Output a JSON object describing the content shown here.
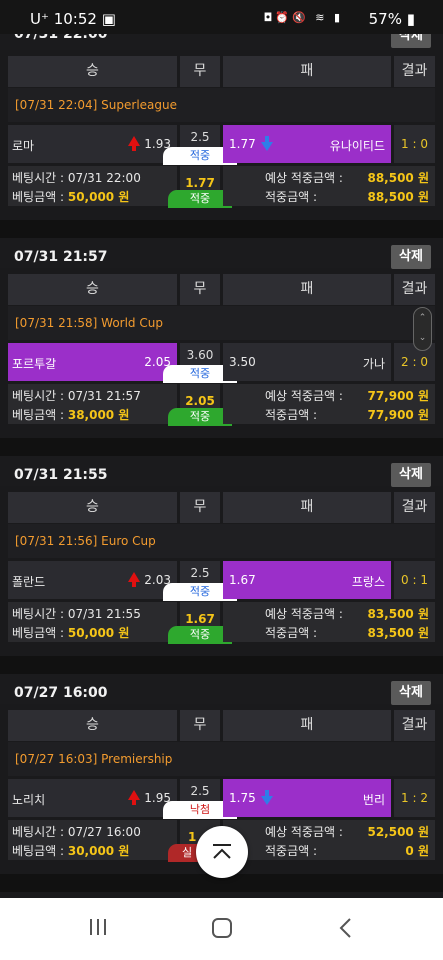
{
  "status_bar": {
    "carrier": "U⁺",
    "time": "10:52",
    "battery": "57%"
  },
  "table_headers": {
    "win": "승",
    "draw": "무",
    "lose": "패",
    "result": "결과"
  },
  "delete_label": "삭제",
  "labels": {
    "bet_time": "베팅시간 : ",
    "bet_amount": "베팅금액 : ",
    "expected_win": "예상 적중금액 :",
    "win_amount": "적중금액 :"
  },
  "bets": [
    {
      "date": "07/31 22:00",
      "league": "[07/31 22:04] Superleague",
      "home": "로마",
      "home_odds": "1.93",
      "draw_odds": "2.5",
      "away": "유나이티드",
      "away_odds": "1.77",
      "result": "1 : 0",
      "status": "적중",
      "bet_time": "07/31 22:00",
      "bet_amount": "50,000 원",
      "picked_odds": "1.77",
      "pick_status": "적중",
      "expected": "88,500 원",
      "won": "88,500 원"
    },
    {
      "date": "07/31 21:57",
      "league": "[07/31 21:58] World Cup",
      "home": "포르투갈",
      "home_odds": "2.05",
      "draw_odds": "3.60",
      "away": "가나",
      "away_odds": "3.50",
      "result": "2 : 0",
      "status": "적중",
      "bet_time": "07/31 21:57",
      "bet_amount": "38,000 원",
      "picked_odds": "2.05",
      "pick_status": "적중",
      "expected": "77,900 원",
      "won": "77,900 원"
    },
    {
      "date": "07/31 21:55",
      "league": "[07/31 21:56] Euro Cup",
      "home": "폴란드",
      "home_odds": "2.03",
      "draw_odds": "2.5",
      "away": "프랑스",
      "away_odds": "1.67",
      "result": "0 : 1",
      "status": "적중",
      "bet_time": "07/31 21:55",
      "bet_amount": "50,000 원",
      "picked_odds": "1.67",
      "pick_status": "적중",
      "expected": "83,500 원",
      "won": "83,500 원"
    },
    {
      "date": "07/27 16:00",
      "league": "[07/27 16:03] Premiership",
      "home": "노리치",
      "home_odds": "1.95",
      "draw_odds": "2.5",
      "away": "번리",
      "away_odds": "1.75",
      "result": "1 : 2",
      "status": "낙첨",
      "bet_time": "07/27 16:00",
      "bet_amount": "30,000 원",
      "picked_odds": "1",
      "pick_status": "실",
      "expected": "52,500 원",
      "won": "0 원"
    }
  ],
  "colors": {
    "accent_purple": "#9b2fc9",
    "win_green": "#2ea82e",
    "league_orange": "#f29b2f",
    "money_yellow": "#f5c518"
  }
}
